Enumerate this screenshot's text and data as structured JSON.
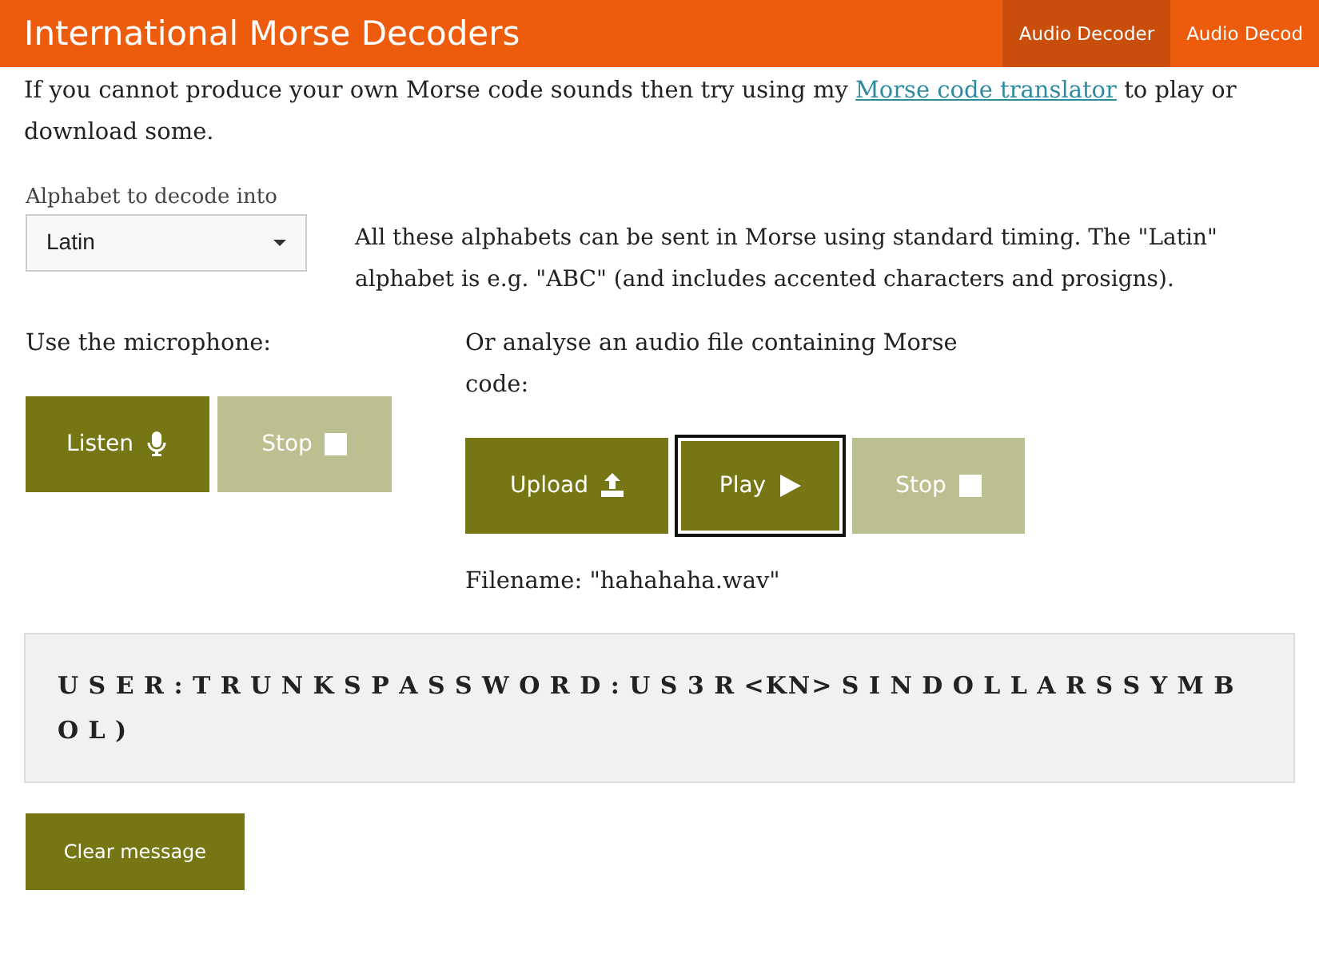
{
  "header": {
    "title": "International Morse Decoders",
    "nav": [
      {
        "label": "Audio Decoder",
        "selected": true
      },
      {
        "label": "Audio Decod",
        "selected": false
      }
    ]
  },
  "intro": {
    "before": "If you cannot produce your own Morse code sounds then try using my ",
    "link": "Morse code translator",
    "after": " to play or download some."
  },
  "alphabet": {
    "label": "Alphabet to decode into",
    "value": "Latin",
    "note": "All these alphabets can be sent in Morse using standard timing. The \"Latin\" alphabet is e.g. \"ABC\" (and includes accented characters and prosigns)."
  },
  "microphone": {
    "heading": "Use the microphone:",
    "buttons": [
      {
        "label": "Listen",
        "kind": "mic",
        "disabled": false,
        "focused": false
      },
      {
        "label": "Stop",
        "kind": "stop",
        "disabled": true,
        "focused": false
      }
    ]
  },
  "file": {
    "heading": "Or analyse an audio file containing Morse code:",
    "buttons": [
      {
        "label": "Upload",
        "kind": "upload",
        "disabled": false,
        "focused": false
      },
      {
        "label": "Play",
        "kind": "play",
        "disabled": false,
        "focused": true
      },
      {
        "label": "Stop",
        "kind": "stop",
        "disabled": true,
        "focused": false
      }
    ],
    "filename": "Filename: \"hahahaha.wav\""
  },
  "message": "U S E R : T R U N K S P A S S W O R D : U S 3 R <KN> S I N D O L L A R S S Y M B O L )",
  "clear_button": "Clear message"
}
